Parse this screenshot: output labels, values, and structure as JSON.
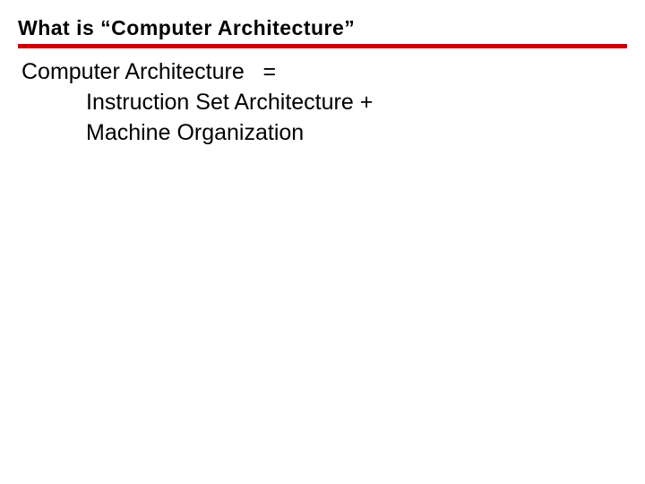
{
  "title": "What is “Computer Architecture”",
  "lines": {
    "line1": "Computer Architecture   = ",
    "line2": "Instruction Set Architecture + ",
    "line3": "Machine Organization"
  }
}
